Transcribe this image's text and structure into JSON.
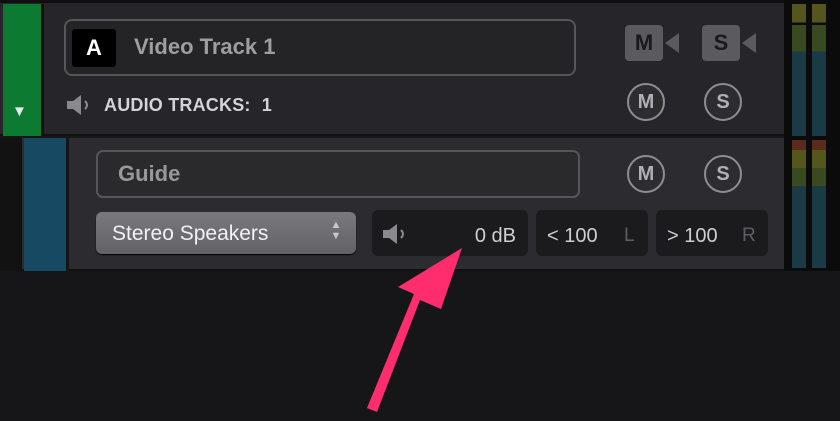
{
  "video_track": {
    "letter_badge": "A",
    "name": "Video Track 1",
    "mute_label": "M",
    "solo_label": "S",
    "audio_tracks_label": "AUDIO TRACKS:",
    "audio_tracks_count": "1",
    "expand_arrow": "▼"
  },
  "audio_track": {
    "name": "Guide",
    "mute_label": "M",
    "solo_label": "S",
    "output": "Stereo Speakers",
    "select_arrows": "▲▼",
    "gain": "0 dB",
    "pan_left": "< 100",
    "pan_left_suffix": "L",
    "pan_right": "> 100",
    "pan_right_suffix": "R"
  },
  "colors": {
    "video_strip": "#0c7a30",
    "audio_strip": "#174a62",
    "callout_arrow": "#ff2d6e"
  },
  "icons": [
    "speaker-icon",
    "camera-icon",
    "chevron-down-icon",
    "updown-arrows-icon"
  ]
}
